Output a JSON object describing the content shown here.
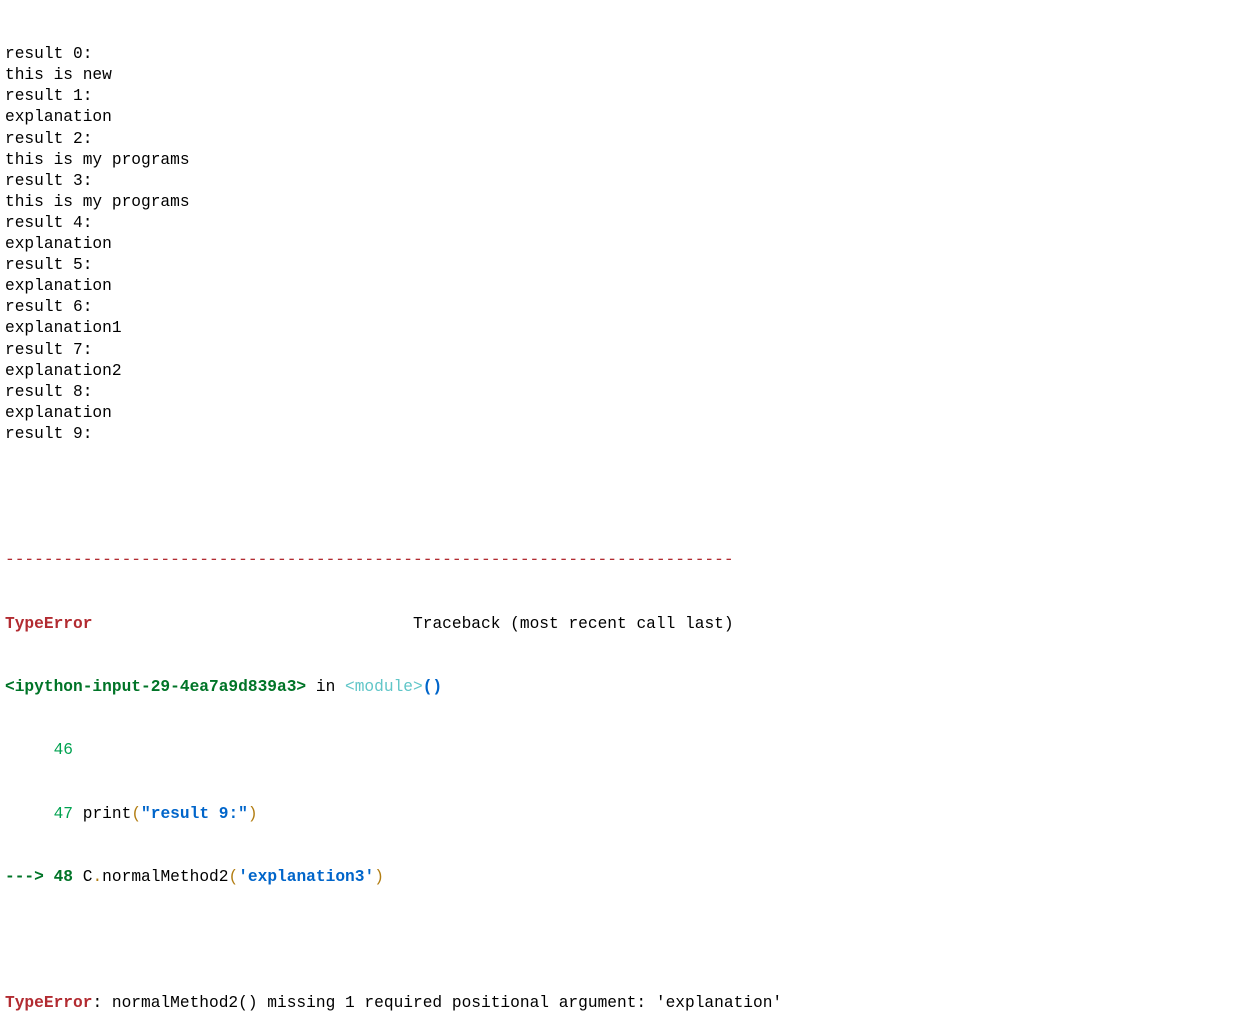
{
  "stdout_lines": [
    "result 0:",
    "this is new",
    "result 1:",
    "explanation",
    "result 2:",
    "this is my programs",
    "result 3:",
    "this is my programs",
    "result 4:",
    "explanation",
    "result 5:",
    "explanation",
    "result 6:",
    "explanation1",
    "result 7:",
    "explanation2",
    "result 8:",
    "explanation",
    "result 9:"
  ],
  "traceback": {
    "separator": "---------------------------------------------------------------------------",
    "error_type": "TypeError",
    "header_gap": "                                 ",
    "header_label": "Traceback (most recent call last)",
    "input_ref": "<ipython-input-29-4ea7a9d839a3>",
    "in_word": " in ",
    "module_ref": "<module>",
    "module_parens": "()",
    "lines": [
      {
        "prefix": "     ",
        "number": "46",
        "code": ""
      },
      {
        "prefix": "     ",
        "number": "47",
        "code_func": " print",
        "open_paren": "(",
        "string": "\"result 9:\"",
        "close_paren": ")"
      }
    ],
    "current_line": {
      "arrow": "---> ",
      "number": "48",
      "obj": " C",
      "dot": ".",
      "method": "normalMethod2",
      "open_paren": "(",
      "string": "'explanation3'",
      "close_paren": ")"
    },
    "final_error": {
      "type": "TypeError",
      "message": ": normalMethod2() missing 1 required positional argument: 'explanation'"
    }
  }
}
